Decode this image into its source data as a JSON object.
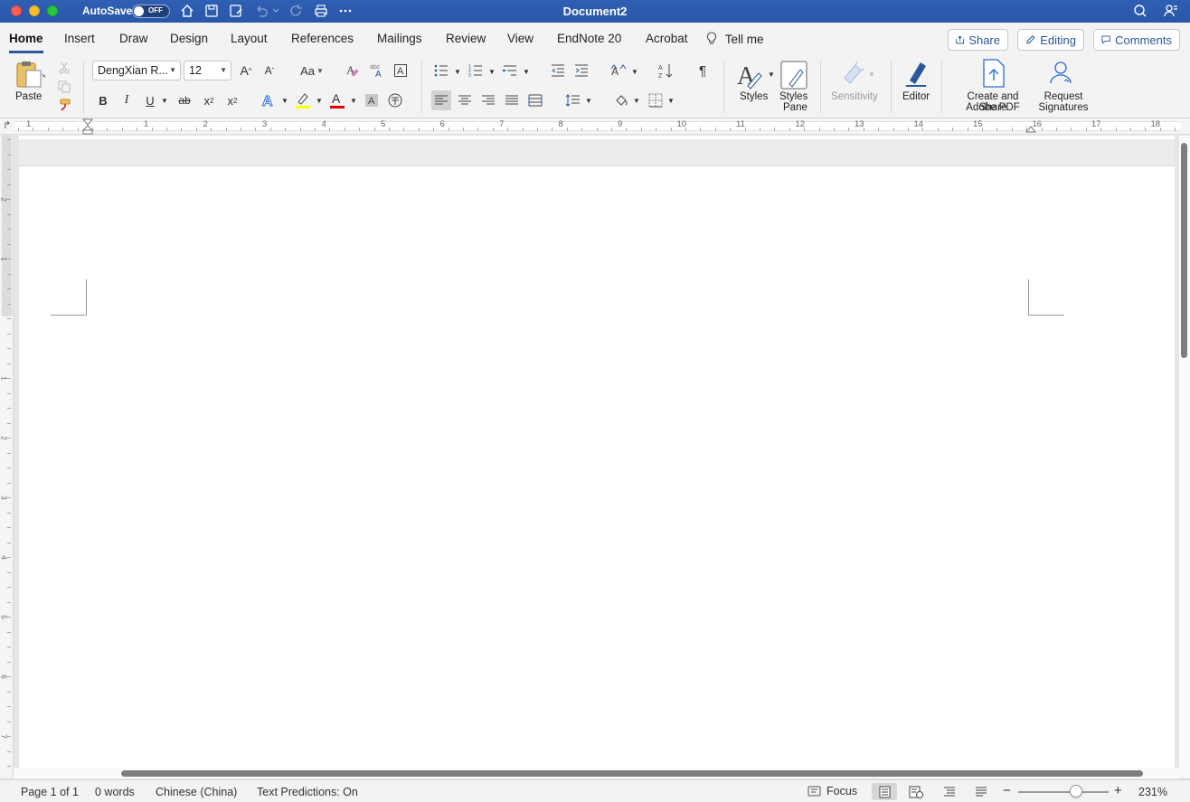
{
  "titlebar": {
    "autosave_label": "AutoSave",
    "autosave_state": "OFF",
    "doc_title": "Document2"
  },
  "tabs": {
    "items": [
      "Home",
      "Insert",
      "Draw",
      "Design",
      "Layout",
      "References",
      "Mailings",
      "Review",
      "View",
      "EndNote 20",
      "Acrobat"
    ],
    "tell_me": "Tell me",
    "share": "Share",
    "editing": "Editing",
    "comments": "Comments"
  },
  "ribbon": {
    "paste": "Paste",
    "font_name": "DengXian R...",
    "font_size": "12",
    "styles": "Styles",
    "styles_pane_1": "Styles",
    "styles_pane_2": "Pane",
    "sensitivity": "Sensitivity",
    "editor": "Editor",
    "pdf_1": "Create and Share",
    "pdf_2": "Adobe PDF",
    "sig_1": "Request",
    "sig_2": "Signatures",
    "bold": "B",
    "italic": "I",
    "underline": "U",
    "strike": "ab",
    "pilcrow": "¶",
    "aa": "Aa"
  },
  "ruler": {
    "numbers": [
      "1",
      "1",
      "2",
      "3",
      "4",
      "5",
      "6",
      "7",
      "8",
      "9",
      "10",
      "11",
      "12",
      "13",
      "14",
      "15",
      "16",
      "17",
      "18"
    ],
    "vertical": [
      "2",
      "1",
      "1",
      "2",
      "3",
      "4",
      "5",
      "6",
      "7"
    ]
  },
  "status": {
    "page": "Page 1 of 1",
    "words": "0 words",
    "language": "Chinese (China)",
    "predictions": "Text Predictions: On",
    "focus": "Focus",
    "zoom": "231%",
    "zoom_level_percent": 231
  },
  "colors": {
    "titlebar": "#2b579a",
    "highlight": "#ffff00",
    "font_color": "#e00000",
    "accent": "#2b579a"
  }
}
